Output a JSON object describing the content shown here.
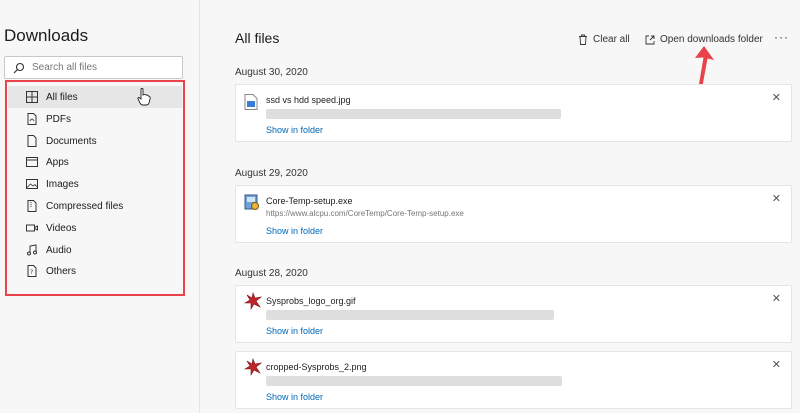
{
  "sidebar": {
    "title": "Downloads",
    "search_placeholder": "Search all files",
    "items": [
      {
        "label": "All files",
        "icon": "grid-icon"
      },
      {
        "label": "PDFs",
        "icon": "pdf-icon"
      },
      {
        "label": "Documents",
        "icon": "document-icon"
      },
      {
        "label": "Apps",
        "icon": "app-icon"
      },
      {
        "label": "Images",
        "icon": "image-icon"
      },
      {
        "label": "Compressed files",
        "icon": "archive-icon"
      },
      {
        "label": "Videos",
        "icon": "video-icon"
      },
      {
        "label": "Audio",
        "icon": "music-icon"
      },
      {
        "label": "Others",
        "icon": "other-file-icon"
      }
    ]
  },
  "main": {
    "title": "All files",
    "clear_all": "Clear all",
    "open_folder": "Open downloads folder",
    "more": "···",
    "groups": [
      {
        "date": "August 30, 2020",
        "files": [
          {
            "name": "ssd vs hdd speed.jpg",
            "url": "",
            "action": "Show in folder",
            "close": "✕"
          }
        ]
      },
      {
        "date": "August 29, 2020",
        "files": [
          {
            "name": "Core-Temp-setup.exe",
            "url": "https://www.alcpu.com/CoreTemp/Core-Temp-setup.exe",
            "action": "Show in folder",
            "close": "✕"
          }
        ]
      },
      {
        "date": "August 28, 2020",
        "files": [
          {
            "name": "Sysprobs_logo_org.gif",
            "url": "",
            "action": "Show in folder",
            "close": "✕"
          },
          {
            "name": "cropped-Sysprobs_2.png",
            "url": "",
            "action": "Show in folder",
            "close": "✕"
          }
        ]
      }
    ]
  },
  "colors": {
    "link": "#0067b8",
    "highlight_box": "#e8434a",
    "active_item": "#e6e6e6"
  }
}
